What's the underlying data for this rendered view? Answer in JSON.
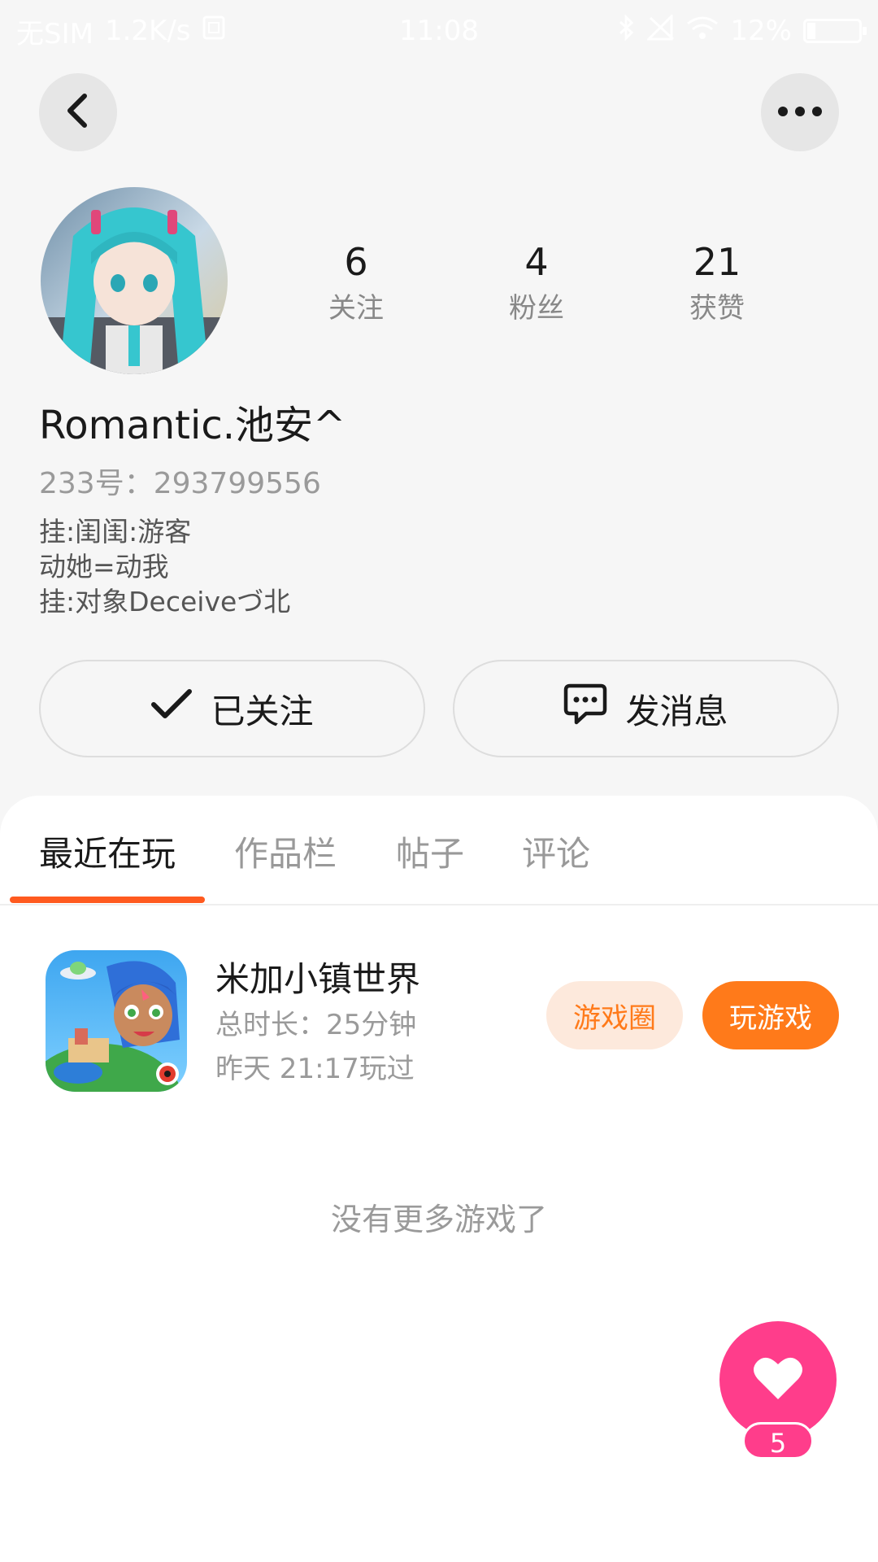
{
  "status_bar": {
    "carrier": "无SIM",
    "net_speed": "1.2K/s",
    "time": "11:08",
    "battery": "12%"
  },
  "profile": {
    "username": "Romantic.池安^",
    "uid": "233号：293799556",
    "bio_lines": [
      "挂:闺闺:游客",
      "动她=动我",
      "挂:对象Deceiveづ北"
    ],
    "stats": [
      {
        "value": "6",
        "label": "关注"
      },
      {
        "value": "4",
        "label": "粉丝"
      },
      {
        "value": "21",
        "label": "获赞"
      }
    ]
  },
  "actions": {
    "follow_label": "已关注",
    "message_label": "发消息"
  },
  "tabs": [
    {
      "label": "最近在玩",
      "active": true
    },
    {
      "label": "作品栏",
      "active": false
    },
    {
      "label": "帖子",
      "active": false
    },
    {
      "label": "评论",
      "active": false
    }
  ],
  "games": [
    {
      "name": "米加小镇世界",
      "total_time": "总时长：25分钟",
      "last_played": "昨天 21:17玩过",
      "circle_label": "游戏圈",
      "play_label": "玩游戏"
    }
  ],
  "no_more_text": "没有更多游戏了",
  "like": {
    "count": "5"
  },
  "colors": {
    "accent": "#ff7a1a",
    "tab_indicator": "#ff5a1f",
    "like": "#ff3d8b"
  },
  "icons": [
    "back-arrow-icon",
    "more-dots-icon",
    "check-icon",
    "chat-bubble-icon",
    "heart-icon"
  ]
}
